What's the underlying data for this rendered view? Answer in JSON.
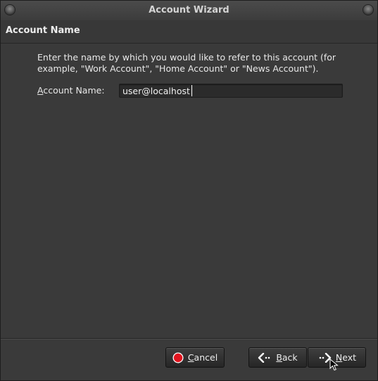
{
  "window": {
    "title": "Account Wizard"
  },
  "page": {
    "heading": "Account Name",
    "description": "Enter the name by which you would like to refer to this account (for example, \"Work Account\", \"Home Account\" or \"News Account\").",
    "field_label_rest": "ccount Name:",
    "field_label_mnemonic": "A",
    "field_value": "user@localhost"
  },
  "buttons": {
    "cancel": "Cancel",
    "back": "Back",
    "next": "Next"
  },
  "icons": {
    "cancel": "stop-icon",
    "back": "back-arrow-icon",
    "next": "next-arrow-icon"
  },
  "colors": {
    "background": "#3a3a3a",
    "stop_red": "#e0141e"
  }
}
